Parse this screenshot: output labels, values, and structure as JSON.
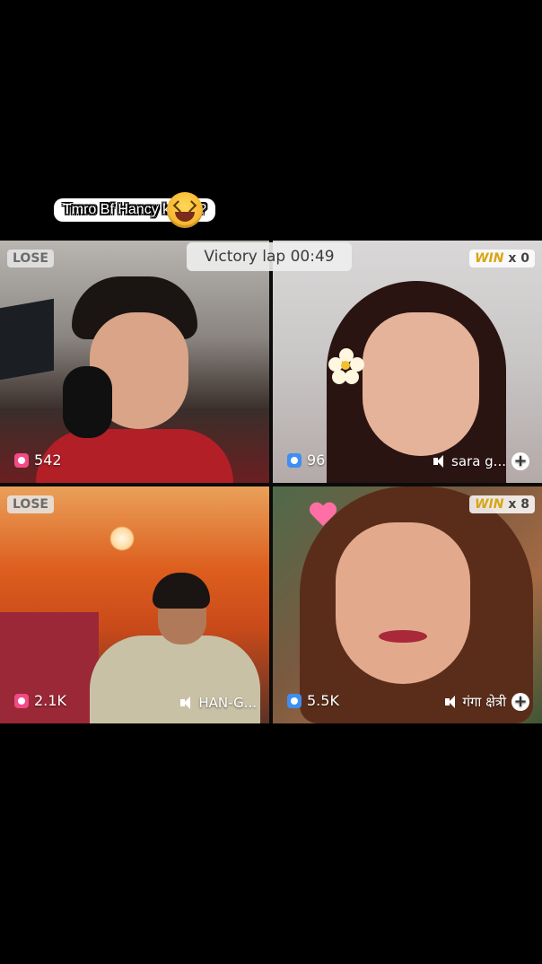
{
  "caption": {
    "text": "Tmro Bf Hancy ki MA?",
    "emoji": "laughing-face"
  },
  "battle": {
    "timer_label": "Victory lap 00:49"
  },
  "tiles": [
    {
      "result": "LOSE",
      "score": "542",
      "icon_color": "#f24a86"
    },
    {
      "result_word": "WIN",
      "result_count": "x 0",
      "score": "96",
      "name": "sara g...",
      "icon_color": "#3f8ef3"
    },
    {
      "result": "LOSE",
      "score": "2.1K",
      "name": "HAN-G...",
      "icon_color": "#f24a86"
    },
    {
      "result_word": "WIN",
      "result_count": "x 8",
      "score": "5.5K",
      "name": "गंगा क्षेत्री",
      "icon_color": "#3f8ef3"
    }
  ],
  "colors": {
    "caption_border": "#e0245e",
    "win_gold": "#d9a514"
  }
}
